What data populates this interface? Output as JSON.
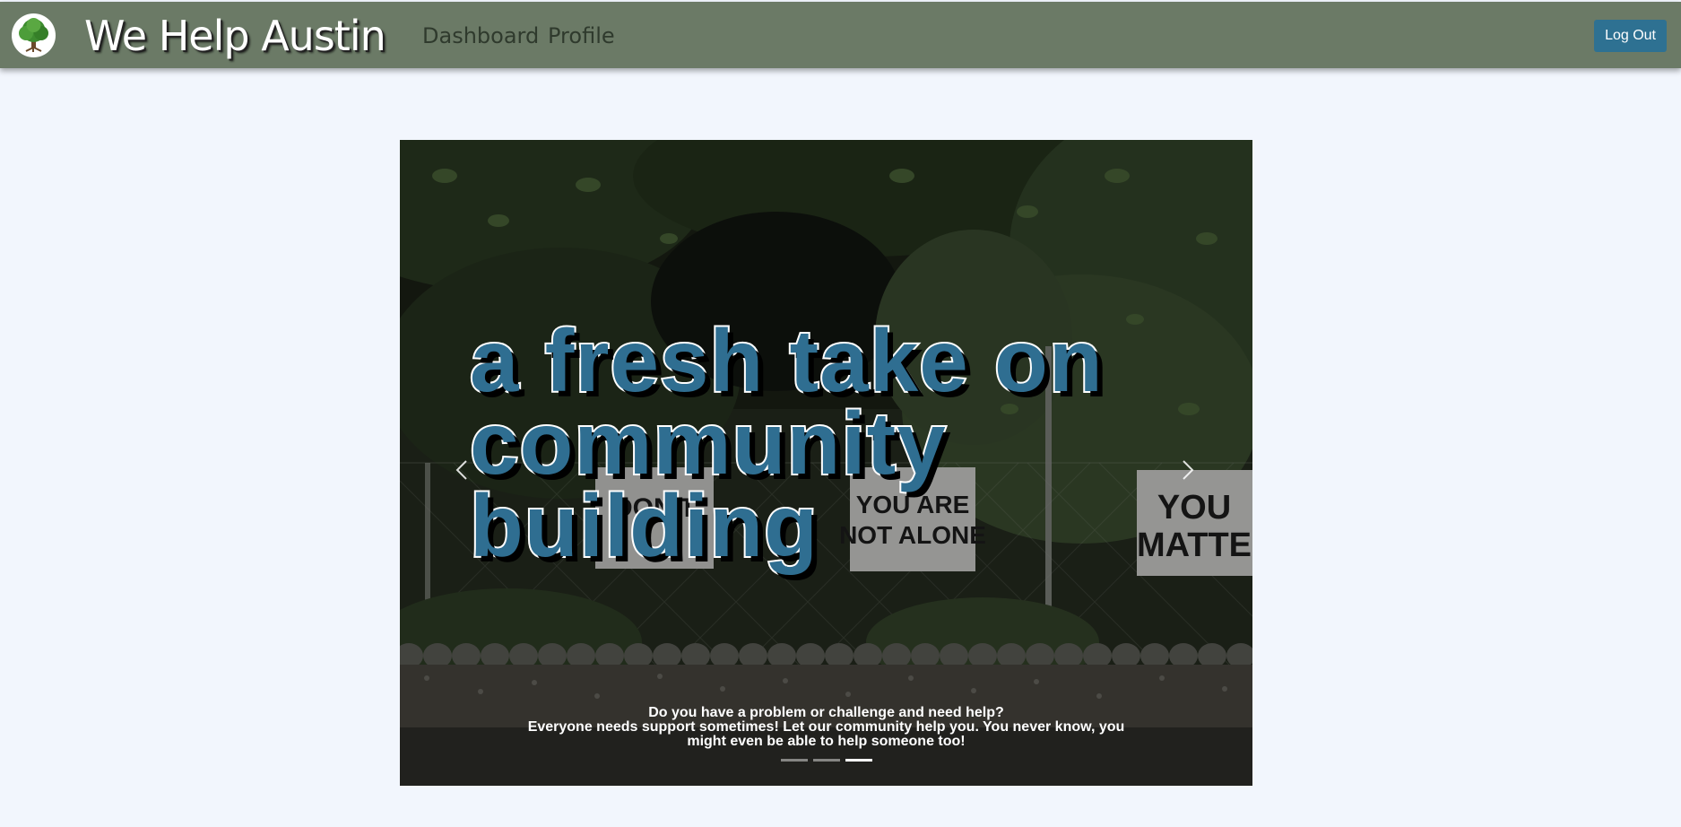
{
  "navbar": {
    "brand": "We Help Austin",
    "links": [
      "Dashboard",
      "Profile"
    ],
    "logout_label": "Log Out"
  },
  "carousel": {
    "headline": "a fresh take on community building",
    "sign_texts": [
      "DON'T",
      "YOU ARE",
      "NOT ALONE",
      "YOU",
      "MATTE"
    ],
    "caption_title": "Do you have a problem or challenge and need help?",
    "caption_text": "Everyone needs support sometimes! Let our community help you. You never know, you might even be able to help someone too!",
    "slide_count": 3,
    "active_slide": 3
  },
  "colors": {
    "navbar_bg": "#6b7a66",
    "logout_bg": "#2e7192",
    "headline_fill": "#2f6e91",
    "page_bg": "#f2f6fd"
  },
  "icons": {
    "logo": "tree-logo-icon",
    "prev": "chevron-left-icon",
    "next": "chevron-right-icon"
  }
}
